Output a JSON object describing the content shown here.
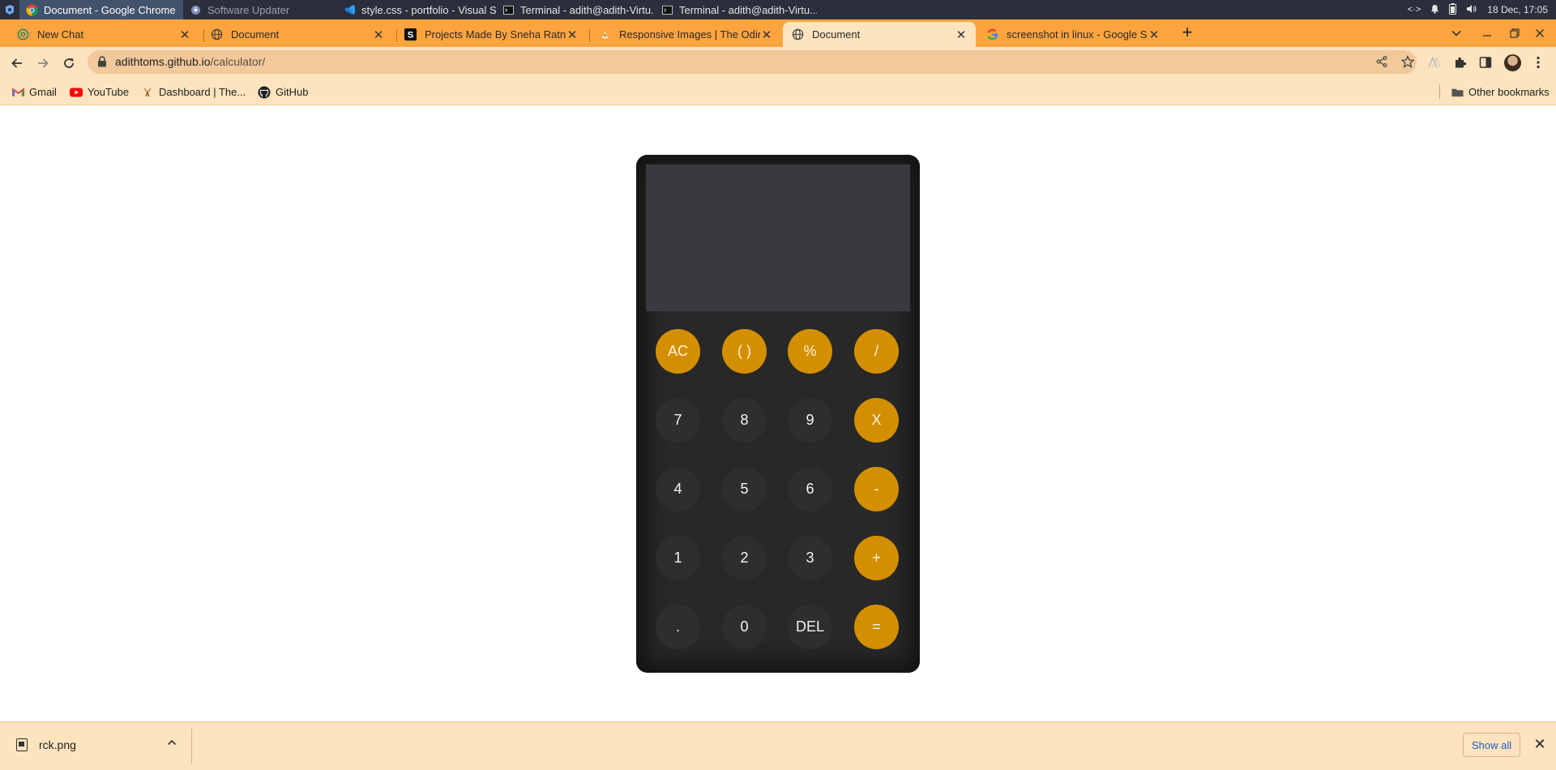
{
  "taskbar": {
    "tasks": [
      {
        "label": "Document - Google Chrome"
      },
      {
        "label": "Software Updater"
      },
      {
        "label": "style.css - portfolio - Visual S..."
      },
      {
        "label": "Terminal - adith@adith-Virtu..."
      },
      {
        "label": "Terminal - adith@adith-Virtu..."
      }
    ],
    "clock": "18 Dec, 17:05"
  },
  "tabs": [
    {
      "title": "New Chat",
      "icon": "chatgpt-icon"
    },
    {
      "title": "Document",
      "icon": "globe-icon"
    },
    {
      "title": "Projects Made By Sneha Ratnani",
      "icon": "s-logo-icon"
    },
    {
      "title": "Responsive Images | The Odin Project",
      "icon": "odin-icon"
    },
    {
      "title": "Document",
      "icon": "globe-icon"
    },
    {
      "title": "screenshot in linux - Google Search",
      "icon": "google-icon"
    }
  ],
  "address_bar": {
    "domain": "adithtoms.github.io",
    "path": "/calculator/"
  },
  "bookmarks": [
    {
      "label": "Gmail"
    },
    {
      "label": "YouTube"
    },
    {
      "label": "Dashboard | The..."
    },
    {
      "label": "GitHub"
    }
  ],
  "other_bookmarks": "Other bookmarks",
  "calculator": {
    "display_value": "",
    "keys": [
      {
        "label": "AC",
        "name": "all-clear-button",
        "op": true
      },
      {
        "label": "( )",
        "name": "parentheses-button",
        "op": true
      },
      {
        "label": "%",
        "name": "percent-button",
        "op": true
      },
      {
        "label": "/",
        "name": "divide-button",
        "op": true
      },
      {
        "label": "7",
        "name": "digit-7-button",
        "op": false
      },
      {
        "label": "8",
        "name": "digit-8-button",
        "op": false
      },
      {
        "label": "9",
        "name": "digit-9-button",
        "op": false
      },
      {
        "label": "X",
        "name": "multiply-button",
        "op": true
      },
      {
        "label": "4",
        "name": "digit-4-button",
        "op": false
      },
      {
        "label": "5",
        "name": "digit-5-button",
        "op": false
      },
      {
        "label": "6",
        "name": "digit-6-button",
        "op": false
      },
      {
        "label": "-",
        "name": "subtract-button",
        "op": true
      },
      {
        "label": "1",
        "name": "digit-1-button",
        "op": false
      },
      {
        "label": "2",
        "name": "digit-2-button",
        "op": false
      },
      {
        "label": "3",
        "name": "digit-3-button",
        "op": false
      },
      {
        "label": "+",
        "name": "add-button",
        "op": true
      },
      {
        "label": ".",
        "name": "decimal-button",
        "op": false
      },
      {
        "label": "0",
        "name": "digit-0-button",
        "op": false
      },
      {
        "label": "DEL",
        "name": "delete-button",
        "op": false
      },
      {
        "label": "=",
        "name": "equals-button",
        "op": true
      }
    ]
  },
  "download_shelf": {
    "file_name": "rck.png",
    "show_all": "Show all"
  },
  "colors": {
    "tabstrip": "#fda43e",
    "toolbar": "#fde3be",
    "calc_body": "#282828",
    "calc_display": "#3a393d",
    "calc_operator": "#d38f00",
    "calc_digit": "#2e2e2e"
  }
}
